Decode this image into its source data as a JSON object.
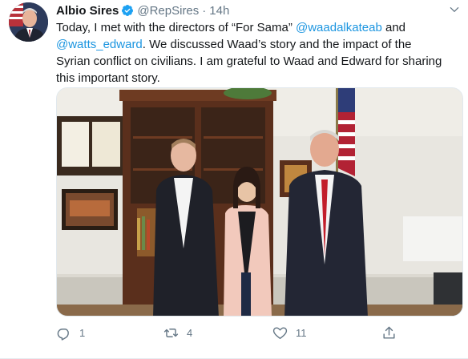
{
  "author": {
    "name": "Albio Sires",
    "handle": "@RepSires",
    "separator": "·",
    "time": "14h",
    "verified": true
  },
  "tweet": {
    "p1": "Today, I met with the directors of “For Sama” ",
    "mention1": "@waadalkateab",
    "p2": " and ",
    "mention2": "@watts_edward",
    "p3": ". We discussed Waad’s story and the impact of the Syrian conflict on civilians. I am grateful to Waad and Edward for sharing this important story."
  },
  "actions": {
    "replies": "1",
    "retweets": "4",
    "likes": "11"
  },
  "colors": {
    "link": "#1b95e0",
    "secondary": "#657786",
    "verified_badge": "#1da1f2"
  },
  "icons": [
    "verified-badge-icon",
    "chevron-down-icon",
    "reply-icon",
    "retweet-icon",
    "like-icon",
    "share-icon"
  ]
}
